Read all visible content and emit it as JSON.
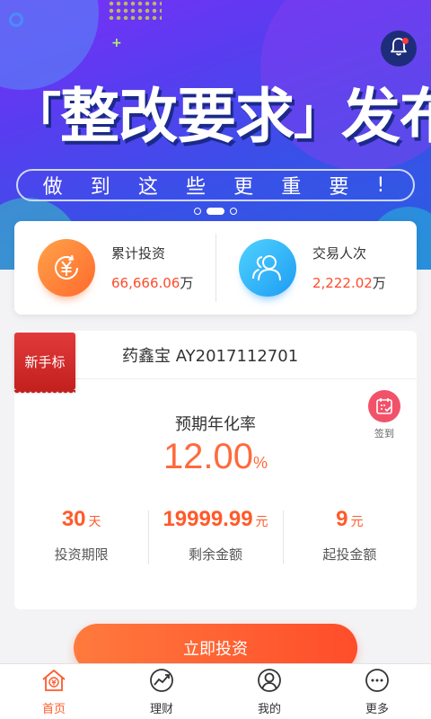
{
  "banner": {
    "headline_left_bracket": "「",
    "headline_main": "整改要求",
    "headline_right_bracket": "」",
    "headline_tail": "发布?",
    "subtitle_chars": [
      "做",
      "到",
      "这",
      "些",
      "更",
      "重",
      "要",
      "!"
    ],
    "pager": {
      "count": 3,
      "active_index": 1
    }
  },
  "notification": {
    "icon": "bell-icon",
    "has_unread": true
  },
  "stats": {
    "total_investment": {
      "label": "累计投资",
      "value": "66,666.06",
      "unit": "万",
      "icon": "yuan-coin-icon"
    },
    "transactions": {
      "label": "交易人次",
      "value": "2,222.02",
      "unit": "万",
      "icon": "users-icon"
    }
  },
  "product": {
    "tag": "新手标",
    "name": "药鑫宝 AY2017112701",
    "checkin_label": "签到",
    "rate_label": "预期年化率",
    "rate_value": "12.00",
    "rate_unit": "%",
    "metrics": [
      {
        "value": "30",
        "unit": "天",
        "caption": "投资期限"
      },
      {
        "value": "19999.99",
        "unit": "元",
        "caption": "剩余金额"
      },
      {
        "value": "9",
        "unit": "元",
        "caption": "起投金额"
      }
    ]
  },
  "invest_button": "立即投资",
  "tabs": [
    {
      "label": "首页",
      "icon": "home-icon",
      "active": true
    },
    {
      "label": "理财",
      "icon": "chart-trend-icon",
      "active": false
    },
    {
      "label": "我的",
      "icon": "user-icon",
      "active": false
    },
    {
      "label": "更多",
      "icon": "more-icon",
      "active": false
    }
  ],
  "colors": {
    "accent": "#ff5a2a",
    "banner": "#4a3cf0",
    "tag_red": "#d12a2a"
  }
}
